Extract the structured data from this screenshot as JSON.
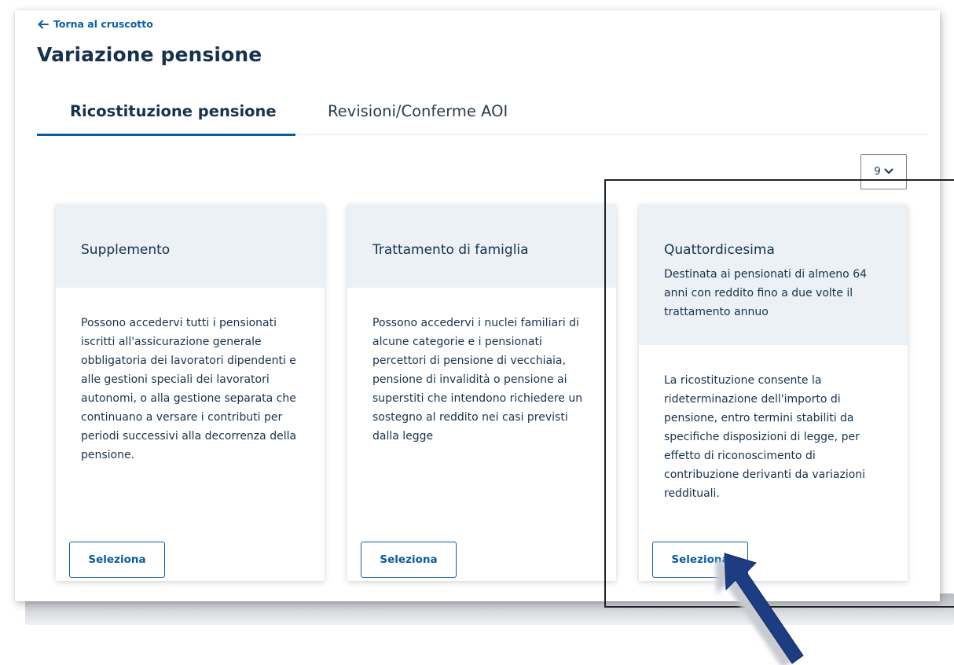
{
  "back_link": {
    "label": "Torna al cruscotto",
    "icon": "arrow-left-icon"
  },
  "page_title": "Variazione pensione",
  "tabs": [
    {
      "label": "Ricostituzione pensione",
      "active": true
    },
    {
      "label": "Revisioni/Conferme AOI",
      "active": false
    }
  ],
  "page_size_select": {
    "value": "9",
    "icon": "chevron-down-icon"
  },
  "cards": [
    {
      "title": "Supplemento",
      "subtitle": "",
      "body": "Possono accedervi tutti i pensionati iscritti all'assicurazione generale obbligatoria dei lavoratori dipendenti e alle gestioni speciali dei lavoratori autonomi, o alla gestione separata che continuano a versare i contributi per periodi successivi alla decorrenza della pensione.",
      "button_label": "Seleziona"
    },
    {
      "title": "Trattamento di famiglia",
      "subtitle": "",
      "body": "Possono accedervi i nuclei familiari di alcune categorie e i pensionati percettori di pensione di vecchiaia, pensione di invalidità o pensione ai superstiti che intendono richiedere un sostegno al reddito nei casi previsti dalla legge",
      "button_label": "Seleziona"
    },
    {
      "title": "Quattordicesima",
      "subtitle": "Destinata ai pensionati di almeno 64 anni con reddito fino a due volte il trattamento annuo",
      "body": "La ricostituzione consente la rideterminazione dell'importo di pensione, entro termini stabiliti da specifiche disposizioni di legge, per effetto di riconoscimento di contribuzione derivanti da variazioni reddituali.",
      "button_label": "Seleziona"
    }
  ],
  "colors": {
    "link_blue": "#0a5c9e",
    "title_navy": "#17324d",
    "card_header_bg": "#ebf1f5",
    "annotation_arrow": "#1d3c82"
  }
}
